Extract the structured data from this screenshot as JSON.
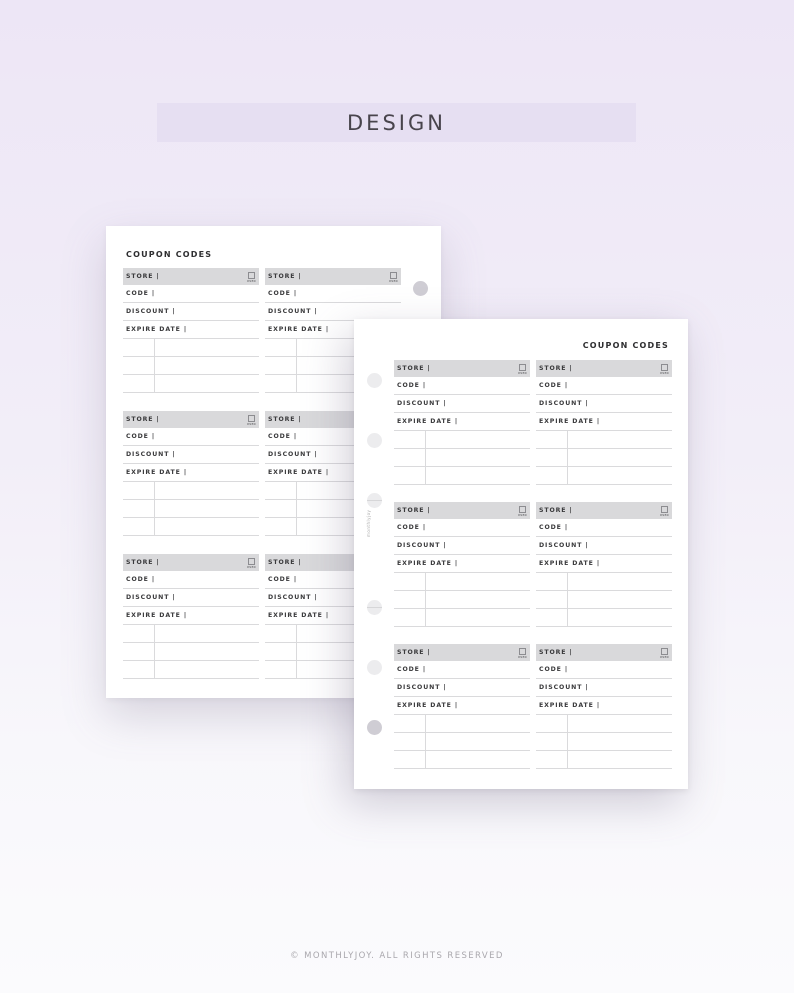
{
  "banner": {
    "title": "DESIGN"
  },
  "pages": [
    {
      "id": "back",
      "title": "COUPON CODES",
      "cards": 6
    },
    {
      "id": "front",
      "title": "COUPON CODES",
      "cards": 6,
      "brand_vertical": "monthlyjoy"
    }
  ],
  "card": {
    "store_label": "STORE |",
    "code_label": "CODE |",
    "discount_label": "DISCOUNT |",
    "expire_label": "EXPIRE DATE |",
    "used_label": "USED"
  },
  "footer": {
    "copyright": "© MONTHLYJOY. ALL RIGHTS RESERVED"
  },
  "colors": {
    "banner_bg": "#e6dff2",
    "store_row_bg": "#d9d9db",
    "text_dark": "#3a3a3c",
    "rule": "#dadadc"
  }
}
